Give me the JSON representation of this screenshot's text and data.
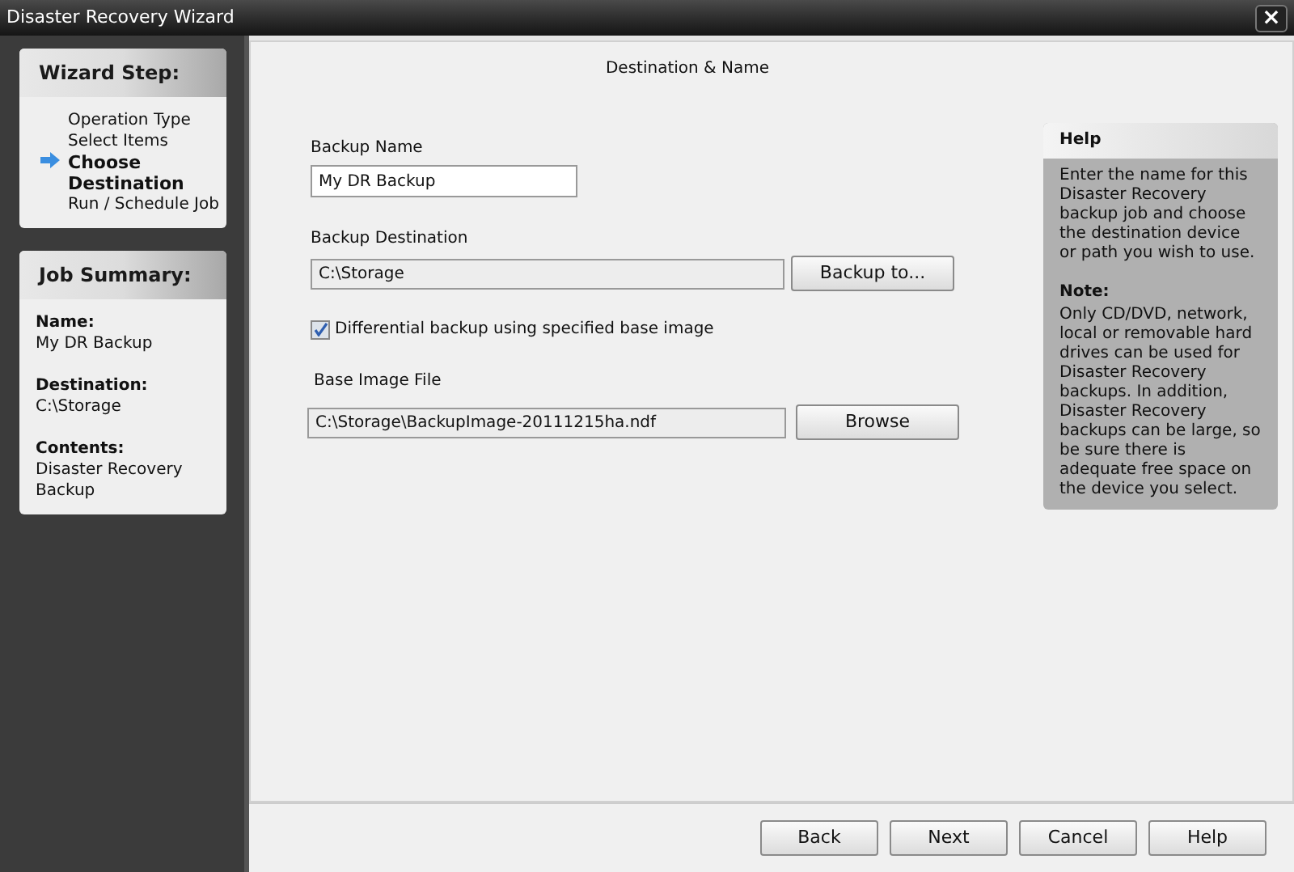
{
  "window": {
    "title": "Disaster Recovery Wizard",
    "close": "×"
  },
  "wizard_steps": {
    "title": "Wizard Step:",
    "items": [
      {
        "label": "Operation Type",
        "selected": false
      },
      {
        "label": "Select Items",
        "selected": false
      },
      {
        "label": "Choose Destination",
        "selected": true
      },
      {
        "label": "Run / Schedule Job",
        "selected": false
      }
    ]
  },
  "job_summary": {
    "title": "Job Summary:",
    "fields": [
      {
        "label": "Name:",
        "value": "My DR Backup"
      },
      {
        "label": "Destination:",
        "value": "C:\\Storage"
      },
      {
        "label": "Contents:",
        "value": "Disaster Recovery Backup"
      }
    ]
  },
  "page_title": "Destination & Name",
  "backup_name": {
    "label": "Backup Name",
    "value": "My DR Backup"
  },
  "backup_destination": {
    "label": "Backup Destination",
    "value": "C:\\Storage",
    "button": "Backup to..."
  },
  "differential": {
    "label": "Differential backup using specified base image",
    "checked": true
  },
  "base_image": {
    "label": "Base Image File",
    "value": "C:\\Storage\\BackupImage-20111215ha.ndf",
    "button": "Browse"
  },
  "help": {
    "title": "Help",
    "text": "Enter the name for this Disaster Recovery backup job and choose the destination device or path you wish to use.",
    "note_title": "Note:",
    "note": "Only CD/DVD, network, local or removable hard drives can be used for Disaster Recovery backups.  In addition, Disaster Recovery backups can be large, so be sure there is adequate free space on the device you select."
  },
  "buttons": [
    "Back",
    "Next",
    "Cancel",
    "Help"
  ]
}
